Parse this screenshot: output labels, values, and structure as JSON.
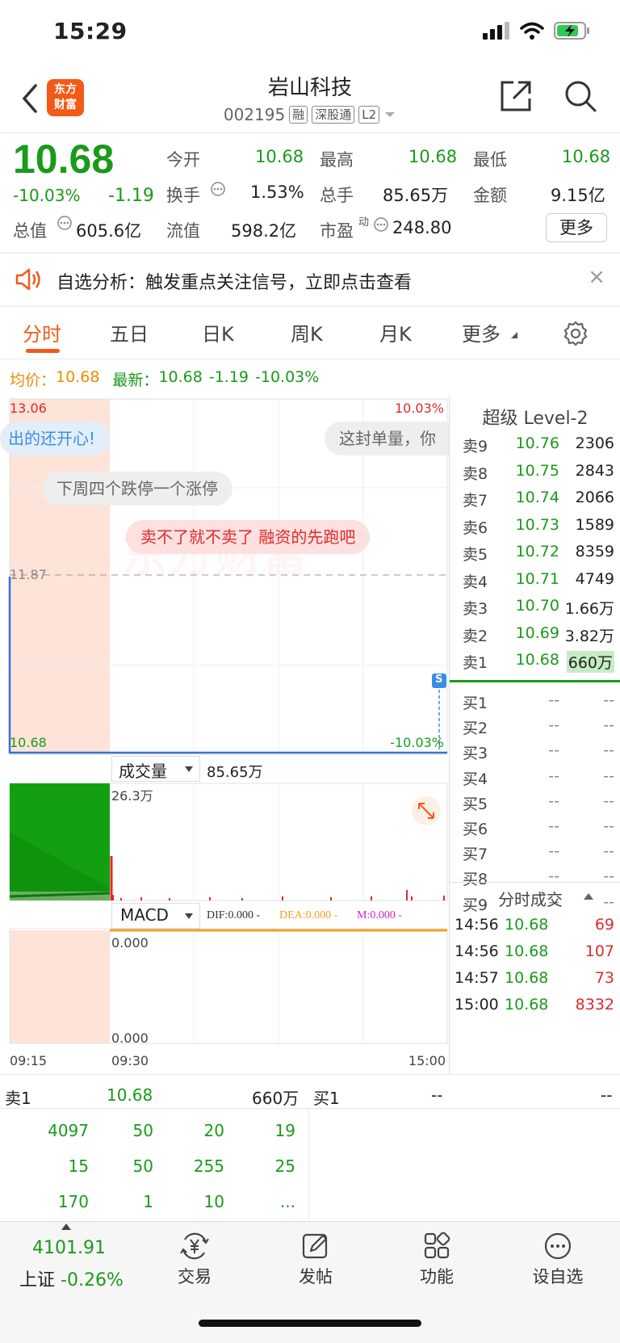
{
  "status": {
    "time": "15:29"
  },
  "nav": {
    "logo_line1": "东方",
    "logo_line2": "财富",
    "stock_name": "岩山科技",
    "code": "002195",
    "tags": [
      "融",
      "深股通",
      "L2"
    ]
  },
  "quote": {
    "price": "10.68",
    "pct": "-10.03%",
    "chg": "-1.19",
    "open_label": "今开",
    "open": "10.68",
    "high_label": "最高",
    "high": "10.68",
    "low_label": "最低",
    "low": "10.68",
    "turnover_label": "换手",
    "turnover": "1.53%",
    "volume_label": "总手",
    "volume": "85.65万",
    "amount_label": "金额",
    "amount": "9.15亿",
    "mktcap_label": "总值",
    "mktcap": "605.6亿",
    "float_label": "流值",
    "float": "598.2亿",
    "pe_label": "市盈",
    "pe_sup": "动",
    "pe": "248.80",
    "more_label": "更多"
  },
  "notice": {
    "text": "自选分析：触发重点关注信号，立即点击查看",
    "close": "×"
  },
  "tabs": [
    {
      "label": "分时"
    },
    {
      "label": "五日"
    },
    {
      "label": "日K"
    },
    {
      "label": "周K"
    },
    {
      "label": "月K"
    },
    {
      "label": "更多"
    }
  ],
  "info_line": {
    "avg_label": "均价：",
    "avg": "10.68",
    "last_label": "最新：",
    "last": "10.68",
    "chg": "-1.19",
    "pct": "-10.03%"
  },
  "chart": {
    "top_price": "13.06",
    "top_pct": "10.03%",
    "mid_price": "11.87",
    "bottom_price": "10.68",
    "bottom_pct": "-10.03%",
    "bubbles": [
      "出的还开心!",
      "这封单量，你",
      "下周四个跌停一个涨停",
      "卖不了就不卖了 融资的先跑吧"
    ],
    "watermark": "东方财富",
    "s_marker": "S",
    "vol_label": "成交量",
    "vol_value": "85.65万",
    "vol_max": "26.3万",
    "macd_label": "MACD",
    "dif": "DIF:0.000 -",
    "dea": "DEA:0.000 -",
    "m": "M:0.000 -",
    "macd_top": "0.000",
    "macd_bottom": "0.000",
    "times": [
      "09:15",
      "09:30",
      "15:00"
    ],
    "colors": {
      "down": "#1a9a1a",
      "up": "#e02a2a",
      "auction": "#fde3d8"
    }
  },
  "book": {
    "title": "超级 Level-2",
    "asks": [
      {
        "label": "卖9",
        "price": "10.76",
        "vol": "2306"
      },
      {
        "label": "卖8",
        "price": "10.75",
        "vol": "2843"
      },
      {
        "label": "卖7",
        "price": "10.74",
        "vol": "2066"
      },
      {
        "label": "卖6",
        "price": "10.73",
        "vol": "1589"
      },
      {
        "label": "卖5",
        "price": "10.72",
        "vol": "8359"
      },
      {
        "label": "卖4",
        "price": "10.71",
        "vol": "4749"
      },
      {
        "label": "卖3",
        "price": "10.70",
        "vol": "1.66万"
      },
      {
        "label": "卖2",
        "price": "10.69",
        "vol": "3.82万"
      },
      {
        "label": "卖1",
        "price": "10.68",
        "vol": "660万"
      }
    ],
    "bids": [
      {
        "label": "买1",
        "price": "--",
        "vol": "--"
      },
      {
        "label": "买2",
        "price": "--",
        "vol": "--"
      },
      {
        "label": "买3",
        "price": "--",
        "vol": "--"
      },
      {
        "label": "买4",
        "price": "--",
        "vol": "--"
      },
      {
        "label": "买5",
        "price": "--",
        "vol": "--"
      },
      {
        "label": "买6",
        "price": "--",
        "vol": "--"
      },
      {
        "label": "买7",
        "price": "--",
        "vol": "--"
      },
      {
        "label": "买8",
        "price": "--",
        "vol": "--"
      },
      {
        "label": "买9",
        "price": "--",
        "vol": "--"
      }
    ],
    "trades_title": "分时成交",
    "trades": [
      {
        "time": "14:56",
        "price": "10.68",
        "vol": "69"
      },
      {
        "time": "14:56",
        "price": "10.68",
        "vol": "107"
      },
      {
        "time": "14:57",
        "price": "10.68",
        "vol": "73"
      },
      {
        "time": "15:00",
        "price": "10.68",
        "vol": "8332"
      }
    ]
  },
  "bottom_quote": {
    "ask_label": "卖1",
    "ask_price": "10.68",
    "ask_vol": "660万",
    "bid_label": "买1",
    "bid_price": "--",
    "bid_vol": "--",
    "rows": [
      [
        "4097",
        "50",
        "20",
        "19"
      ],
      [
        "15",
        "50",
        "255",
        "25"
      ],
      [
        "170",
        "1",
        "10",
        "..."
      ]
    ]
  },
  "bottom_bar": {
    "index_value": "4101.91",
    "index_name": "上证",
    "index_pct": "-0.26%",
    "items": [
      {
        "label": "交易"
      },
      {
        "label": "发帖"
      },
      {
        "label": "功能"
      },
      {
        "label": "设自选"
      }
    ]
  }
}
